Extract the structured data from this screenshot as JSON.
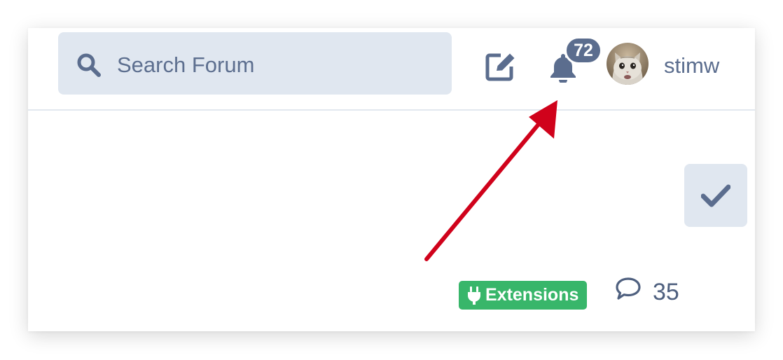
{
  "header": {
    "search": {
      "placeholder": "Search Forum",
      "icon": "search-icon"
    },
    "compose": {
      "icon": "edit-icon"
    },
    "notifications": {
      "icon": "bell-icon",
      "count": "72"
    },
    "user": {
      "name": "stimw",
      "avatar": "cat-avatar"
    }
  },
  "discussion": {
    "mark_read": {
      "icon": "check-icon"
    },
    "tag": {
      "label": "Extensions",
      "icon": "plug-icon",
      "color": "#38b66a"
    },
    "replies": {
      "icon": "comment-icon",
      "count": "35"
    }
  },
  "annotation": {
    "color": "#d0021b"
  },
  "colors": {
    "accent": "#5b6d8e",
    "control_bg": "#e0e7f0"
  }
}
